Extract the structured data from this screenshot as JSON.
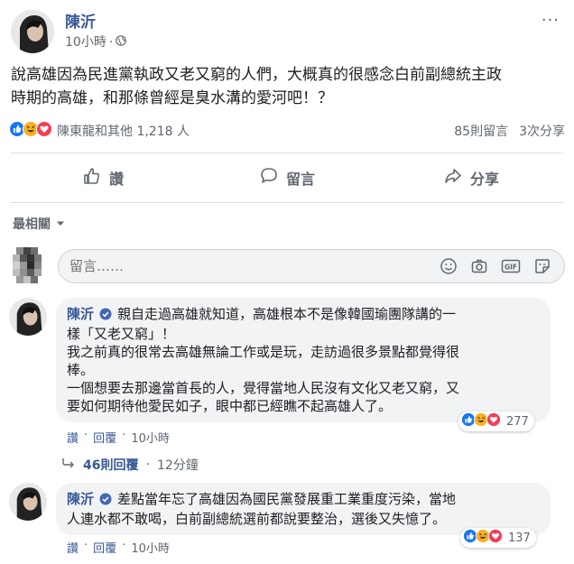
{
  "post": {
    "author": "陳沂",
    "time": "10小時",
    "privacy_icon": "globe-icon",
    "text_lines": [
      "說高雄因為民進黨執政又老又窮的人們，大概真的很感念白前副總統主政",
      "時期的高雄，和那條曾經是臭水溝的愛河吧！？"
    ],
    "more_label": "···"
  },
  "stats": {
    "reaction_icons": [
      "like-icon",
      "haha-icon",
      "love-icon"
    ],
    "reactors": "陳東龍和其他 1,218 人",
    "comments": "85則留言",
    "shares": "3次分享"
  },
  "actions": {
    "like": "讚",
    "comment": "留言",
    "share": "分享"
  },
  "sort": {
    "label": "最相關"
  },
  "composer": {
    "placeholder": "留言……"
  },
  "comments": [
    {
      "author": "陳沂",
      "lines": [
        "親自走過高雄就知道，高雄根本不是像韓國瑜團隊講的一",
        "樣「又老又窮」！",
        "我之前真的很常去高雄無論工作或是玩，走訪過很多景點都覺得很",
        "棒。",
        "一個想要去那邊當首長的人，覺得當地人民沒有文化又老又窮，又",
        "要如何期待他愛民如子，眼中都已經瞧不起高雄人了。"
      ],
      "reaction_count": "277",
      "like_label": "讚",
      "reply_label": "回覆",
      "time": "10小時"
    },
    {
      "author": "陳沂",
      "lines": [
        "差點當年忘了高雄因為國民黨發展重工業重度污染，當地",
        "人連水都不敢喝，白前副總統選前都說要整治，選後又失憶了。"
      ],
      "reaction_count": "137",
      "like_label": "讚",
      "reply_label": "回覆",
      "time": "10小時"
    }
  ],
  "replies": {
    "count_label": "46則回覆",
    "time": "12分鐘"
  },
  "colors": {
    "link": "#385898",
    "secondary_text": "#606770",
    "like_blue": "#1877f2",
    "love_red": "#f33e58",
    "haha_yellow": "#f7b125",
    "bubble_bg": "#f2f3f5"
  }
}
